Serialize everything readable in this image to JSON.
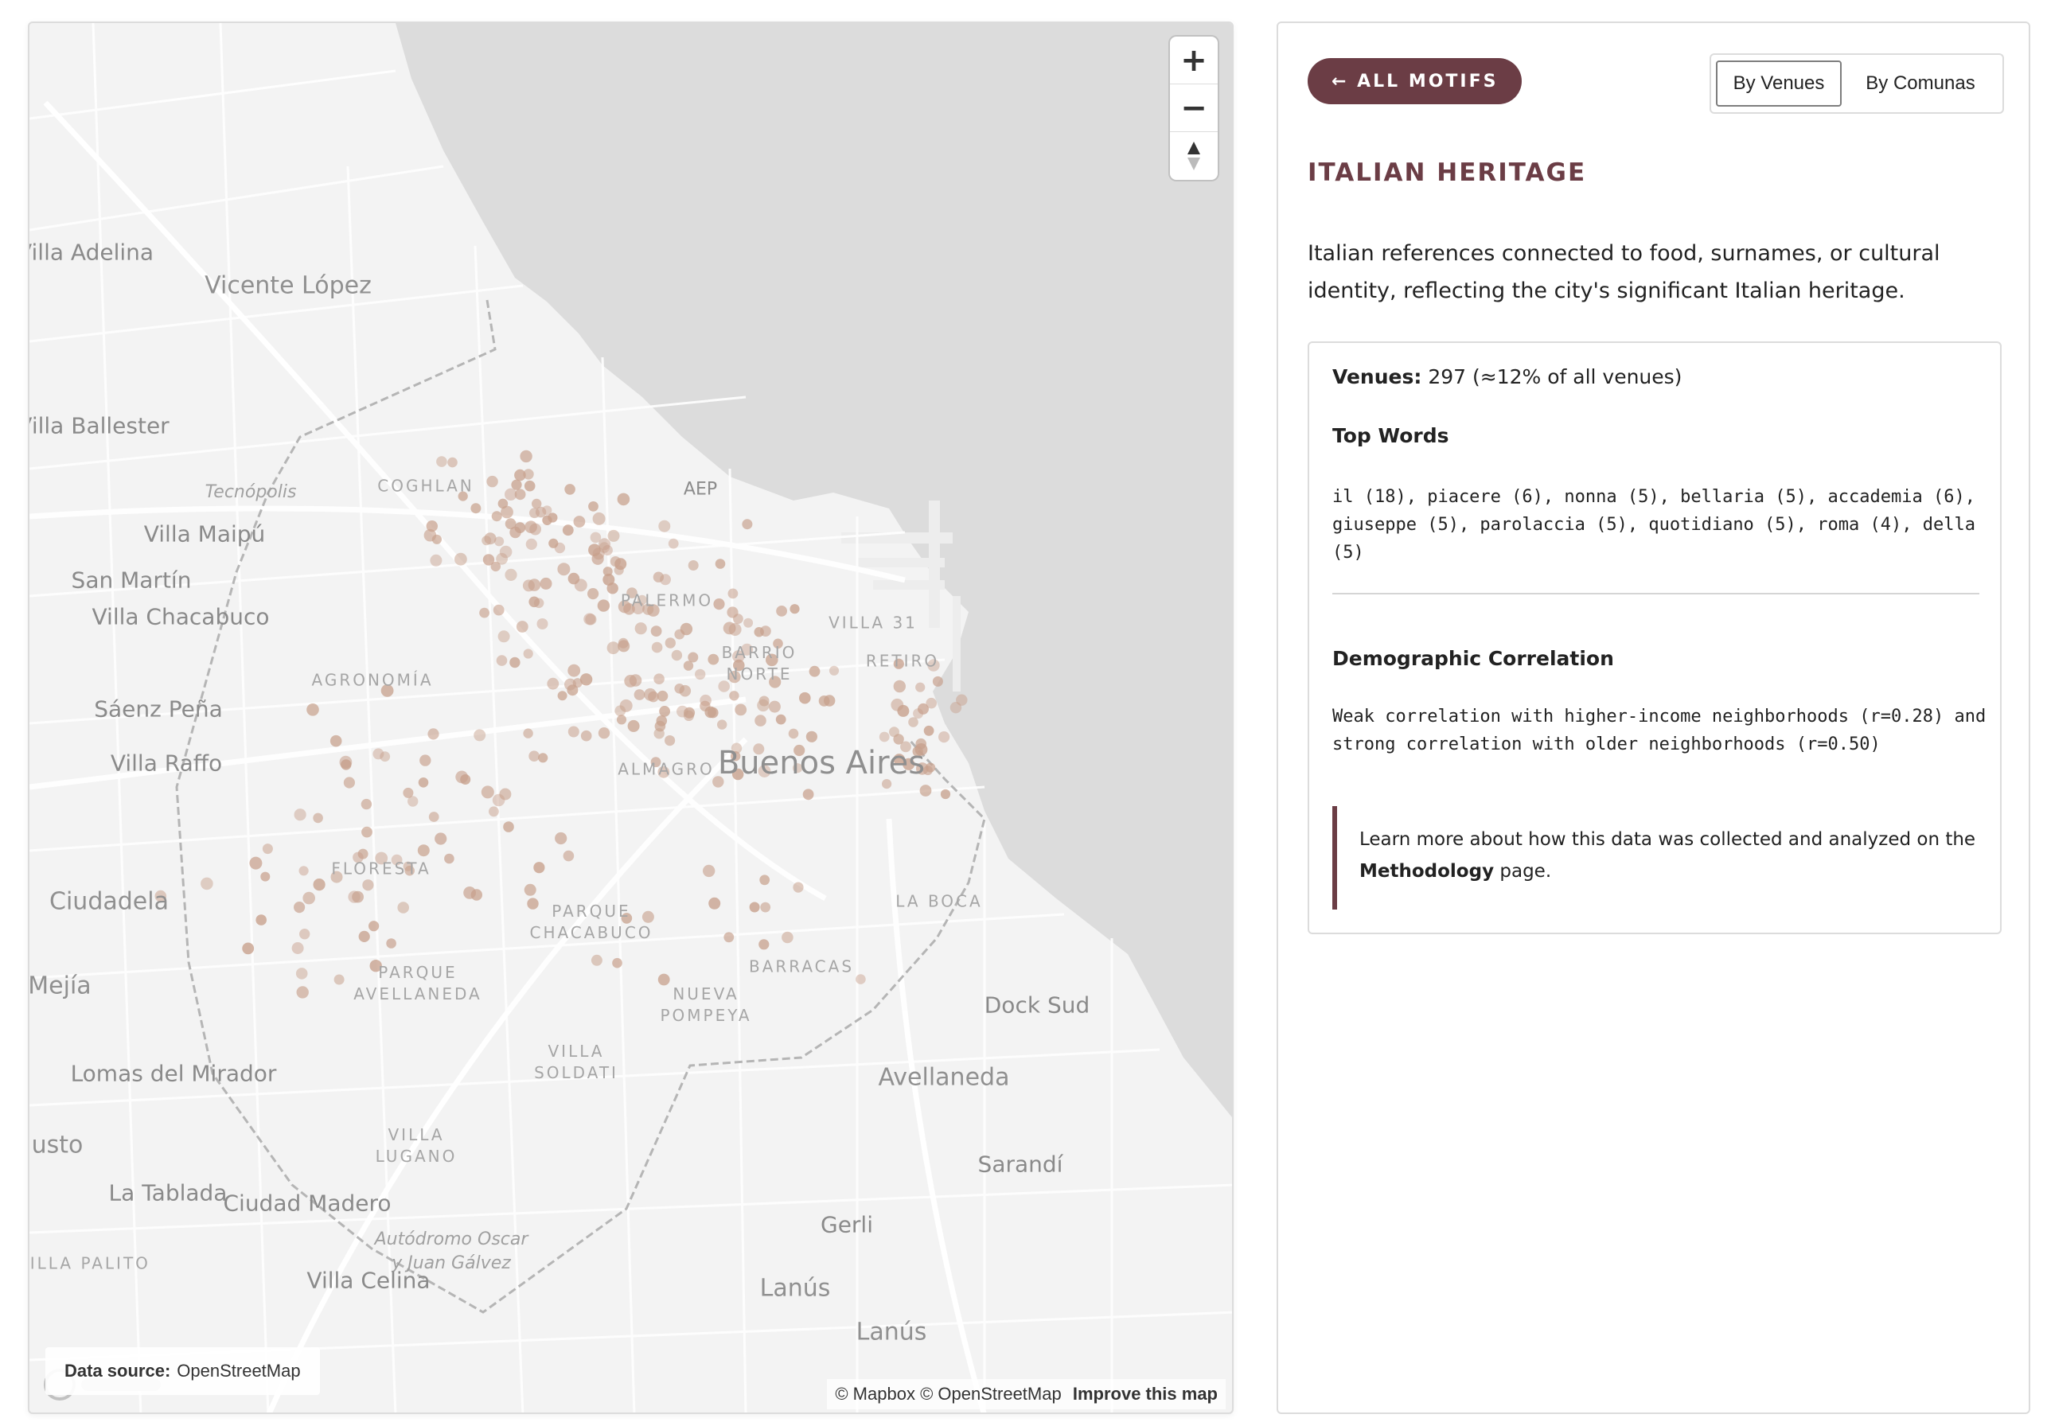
{
  "map": {
    "place_labels": [
      {
        "text": "Villa Adelina",
        "class": "lbl-city"
      },
      {
        "text": "Vicente López",
        "class": "lbl-large"
      },
      {
        "text": "Villa Ballester",
        "class": "lbl-city"
      },
      {
        "text": "Tecnópolis",
        "class": "lbl-poi"
      },
      {
        "text": "Villa Maipú",
        "class": "lbl-city"
      },
      {
        "text": "San Martín",
        "class": "lbl-city"
      },
      {
        "text": "Villa Chacabuco",
        "class": "lbl-city"
      },
      {
        "text": "Sáenz Peña",
        "class": "lbl-city"
      },
      {
        "text": "Villa Raffo",
        "class": "lbl-city"
      },
      {
        "text": "Ciudadela",
        "class": "lbl-large"
      },
      {
        "text": "Mejía",
        "class": "lbl-large"
      },
      {
        "text": "Lomas del\nMirador",
        "class": "lbl-city"
      },
      {
        "text": "usto",
        "class": "lbl-large"
      },
      {
        "text": "La Tablada",
        "class": "lbl-city"
      },
      {
        "text": "Ciudad Madero",
        "class": "lbl-city"
      },
      {
        "text": "VILLA PALITO",
        "class": "lbl-hood"
      },
      {
        "text": "Autódromo Oscar\ny Juan Gálvez",
        "class": "lbl-poi"
      },
      {
        "text": "Villa Celina",
        "class": "lbl-city"
      },
      {
        "text": "Buenos Aires",
        "class": "lbl-main"
      },
      {
        "text": "Dock Sud",
        "class": "lbl-city"
      },
      {
        "text": "Avellaneda",
        "class": "lbl-large"
      },
      {
        "text": "Sarandí",
        "class": "lbl-city"
      },
      {
        "text": "Gerli",
        "class": "lbl-city"
      },
      {
        "text": "Lanús",
        "class": "lbl-large"
      },
      {
        "text": "Lanús",
        "class": "lbl-large"
      },
      {
        "text": "AEP",
        "class": "lbl-aep"
      },
      {
        "text": "COGHLAN",
        "class": "lbl-hood"
      },
      {
        "text": "PALERMO",
        "class": "lbl-hood"
      },
      {
        "text": "VILLA 31",
        "class": "lbl-hood"
      },
      {
        "text": "BARRIO\nNORTE",
        "class": "lbl-hood"
      },
      {
        "text": "RETIRO",
        "class": "lbl-hood"
      },
      {
        "text": "AGRONOMÍA",
        "class": "lbl-hood"
      },
      {
        "text": "ALMAGRO",
        "class": "lbl-hood"
      },
      {
        "text": "FLORESTA",
        "class": "lbl-hood"
      },
      {
        "text": "PARQUE\nCHACABUCO",
        "class": "lbl-hood"
      },
      {
        "text": "LA BOCA",
        "class": "lbl-hood"
      },
      {
        "text": "PARQUE\nAVELLANEDA",
        "class": "lbl-hood"
      },
      {
        "text": "BARRACAS",
        "class": "lbl-hood"
      },
      {
        "text": "NUEVA\nPOMPEYA",
        "class": "lbl-hood"
      },
      {
        "text": "VILLA\nSOLDATI",
        "class": "lbl-hood"
      },
      {
        "text": "VILLA\nLUGANO",
        "class": "lbl-hood"
      }
    ],
    "venue_color": "#c7a08c",
    "land_color": "#f3f3f3",
    "water_color": "#dcdcdc",
    "boundary_color": "#b5b5b5",
    "zoom_in_label": "+",
    "zoom_out_label": "−",
    "compass_icon": "compass-north-icon",
    "data_source_label": "Data source:",
    "data_source_value": "OpenStreetMap",
    "attribution_mapbox": "© Mapbox",
    "attribution_osm": "© OpenStreetMap",
    "attribution_improve": "Improve this map"
  },
  "sidebar": {
    "back_button": "← ALL MOTIFS",
    "toggle": {
      "venues": "By Venues",
      "comunas": "By Comunas",
      "active": "venues"
    },
    "title": "ITALIAN HERITAGE",
    "description": "Italian references connected to food, surnames, or cultural identity, reflecting the city's significant Italian heritage.",
    "accent_color": "#6b3d45",
    "card": {
      "venues_label": "Venues:",
      "venues_value": "297 (≈12% of all venues)",
      "venues_count": 297,
      "top_words_heading": "Top Words",
      "top_words": "il (18), piacere (6), nonna (5), bellaria (5), accademia (6), giuseppe (5), parolaccia (5), quotidiano (5), roma (4), della (5)",
      "demographic_heading": "Demographic Correlation",
      "demographic_text": "Weak correlation with higher-income neighborhoods (r=0.28) and strong correlation with older neighborhoods (r=0.50)",
      "methodology_prefix": "Learn more about how this data was collected and analyzed on the",
      "methodology_link": "Methodology",
      "methodology_suffix": "page."
    }
  }
}
